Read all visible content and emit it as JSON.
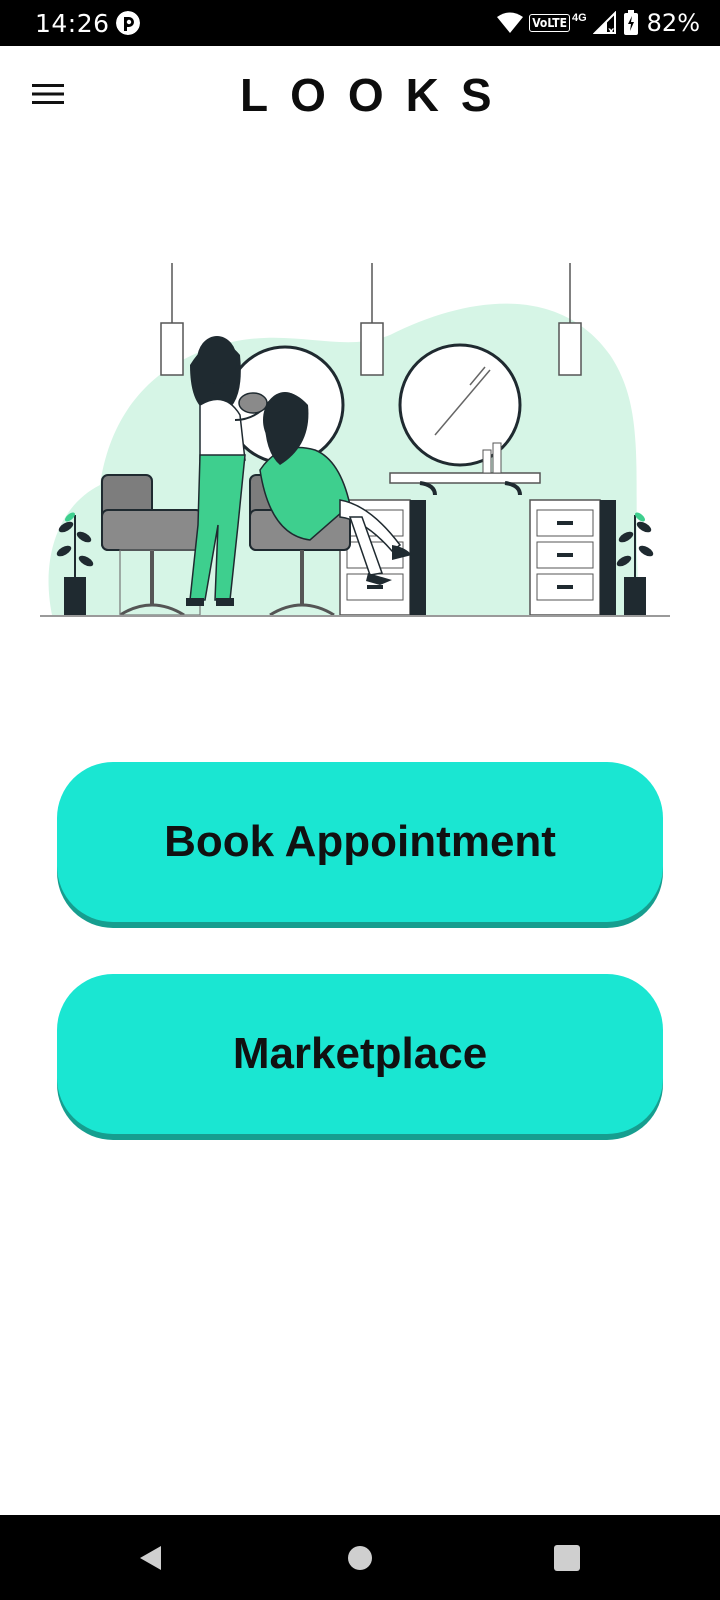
{
  "status_bar": {
    "time": "14:26",
    "volte": "VoLTE",
    "network": "4G",
    "battery": "82%"
  },
  "app_bar": {
    "title": "LOOKS",
    "menu_icon": "hamburger-menu-icon"
  },
  "illustration": {
    "subject": "salon-illustration",
    "accent_color": "#d6f5e6",
    "green": "#3ecf8e",
    "dark": "#1f2a30"
  },
  "actions": {
    "book_label": "Book Appointment",
    "market_label": "Marketplace",
    "button_color": "#1ae6d2",
    "button_shadow": "#169e8f"
  },
  "nav_bar": {
    "back_icon": "back-triangle-icon",
    "home_icon": "home-circle-icon",
    "recents_icon": "recents-square-icon"
  }
}
